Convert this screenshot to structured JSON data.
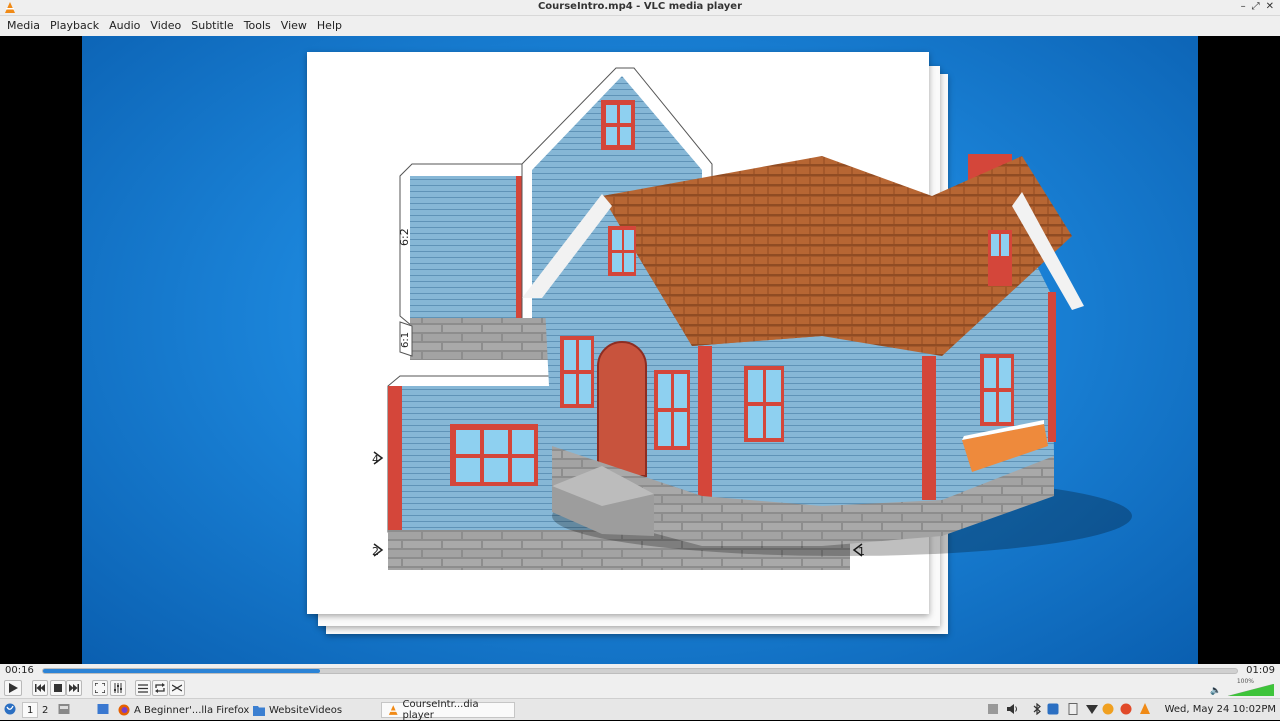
{
  "window": {
    "title": "CourseIntro.mp4 - VLC media player"
  },
  "menu": [
    "Media",
    "Playback",
    "Audio",
    "Video",
    "Subtitle",
    "Tools",
    "View",
    "Help"
  ],
  "player": {
    "elapsed": "00:16",
    "total": "01:09",
    "progress": 0.232,
    "volume_pct": "100%",
    "volume_level": 1.0
  },
  "video": {
    "template_labels": [
      "6:2",
      "6:1",
      "4",
      "2",
      "1"
    ],
    "colors": {
      "background": "#1b84d9",
      "siding": "#7fb3d4",
      "trim": "#d4463a",
      "roof": "#a65a2a",
      "stone": "#9b9b9b"
    }
  },
  "controls": {
    "play": "play-icon",
    "prev": "previous-icon",
    "stop": "stop-icon",
    "next": "next-icon",
    "fullscreen": "fullscreen-icon",
    "extended": "equalizer-icon",
    "playlist": "playlist-icon",
    "loop": "loop-icon",
    "random": "shuffle-icon"
  },
  "taskbar": {
    "workspaces": [
      "1",
      "2"
    ],
    "tasks": [
      {
        "label": "A Beginner'...lla Firefox",
        "icon": "firefox-icon",
        "active": false
      },
      {
        "label": "WebsiteVideos",
        "icon": "folder-icon",
        "active": false
      },
      {
        "label": "CourseIntr...dia player",
        "icon": "vlc-icon",
        "active": true
      }
    ],
    "clock": "Wed, May 24 10:02PM"
  }
}
